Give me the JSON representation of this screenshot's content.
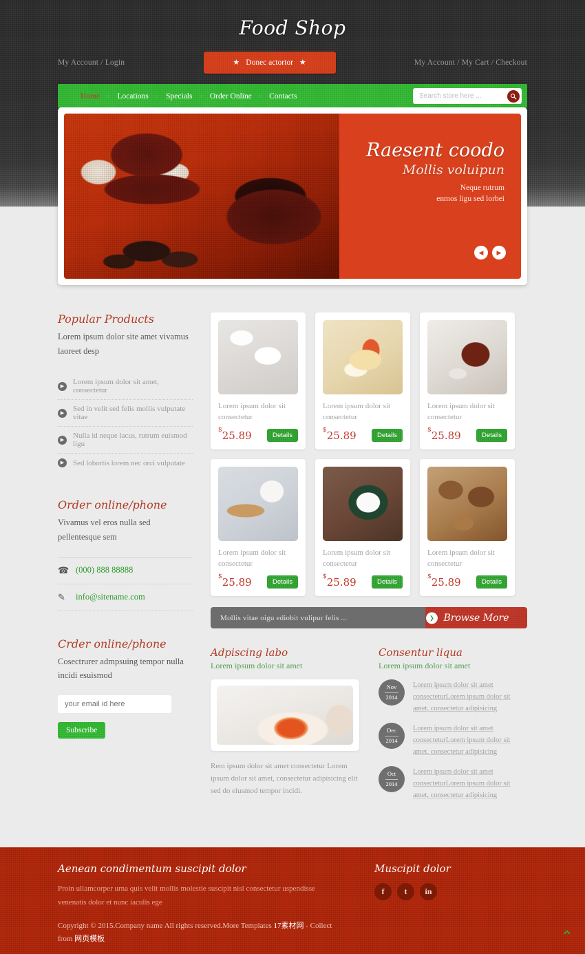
{
  "header": {
    "site_title": "Food Shop",
    "left_link": "My Account / Login",
    "right_link": "My Account / My Cart / Checkout",
    "promo_button": "Donec actortor",
    "star_icon": "★"
  },
  "nav": {
    "items": [
      {
        "label": "Home",
        "active": true
      },
      {
        "label": "Locations",
        "active": false
      },
      {
        "label": "Specials",
        "active": false
      },
      {
        "label": "Order Online",
        "active": false
      },
      {
        "label": "Contacts",
        "active": false
      }
    ],
    "separator": "-",
    "search_placeholder": "Search store here ...",
    "search_value": ""
  },
  "hero": {
    "title": "Raesent coodo",
    "subtitle": "Mollis voluipun",
    "line1": "Neque rutrum",
    "line2": "enmos ligu sed lorbei",
    "prev_icon": "◀",
    "next_icon": "▶"
  },
  "sidebar": {
    "popular": {
      "title": "Popular Products",
      "desc": "Lorem ipsum dolor site amet vivamus laoreet desp",
      "items": [
        "Lorem ipsum dolor sit amet, consectetur",
        "Sed in velit sed felis mollis vulputate vitae",
        "Nulla id neque lacus, rutrum euismod ligu",
        "Sed lobortis lorem nec orci vulputate"
      ]
    },
    "order": {
      "title": "Order online/phone",
      "desc": "Vivamus vel eros nulla sed pellentesque sem",
      "phone": "(000) 888 88888",
      "email": "info@sitename.com",
      "phone_icon": "☎",
      "email_icon": "✎"
    },
    "newsletter": {
      "title": "Crder online/phone",
      "desc": "Cosectrurer admpsuing tempor nulla incidi esuismod",
      "input_placeholder": "your email id here",
      "input_value": "",
      "button": "Subscribe"
    }
  },
  "products": [
    {
      "desc": "Lorem ipsum dolor sit consectetur",
      "price": "25.89",
      "currency": "$",
      "details": "Details",
      "img": "p1"
    },
    {
      "desc": "Lorem ipsum dolor sit consectetur",
      "price": "25.89",
      "currency": "$",
      "details": "Details",
      "img": "p2"
    },
    {
      "desc": "Lorem ipsum dolor sit consectetur",
      "price": "25.89",
      "currency": "$",
      "details": "Details",
      "img": "p3"
    },
    {
      "desc": "Lorem ipsum dolor sit consectetur",
      "price": "25.89",
      "currency": "$",
      "details": "Details",
      "img": "p4"
    },
    {
      "desc": "Lorem ipsum dolor sit consectetur",
      "price": "25.89",
      "currency": "$",
      "details": "Details",
      "img": "p5"
    },
    {
      "desc": "Lorem ipsum dolor sit consectetur",
      "price": "25.89",
      "currency": "$",
      "details": "Details",
      "img": "p6"
    }
  ],
  "browse": {
    "text": "Mollis vitae oigu ediobit vulipur felis ...",
    "button": "Browse More",
    "knob_icon": "❯"
  },
  "bottom": {
    "left": {
      "title": "Adpiscing labo",
      "subtitle": "Lorem ipsum dolor sit amet",
      "body": "Rem ipsum dolor sit amet consectetur Lorem ipsum dolor sit amet, consectetur adipisicing elit sed do eiusmod tempor incidi."
    },
    "right": {
      "title": "Consentur liqua",
      "subtitle": "Lorem ipsum dolor sit amet",
      "items": [
        {
          "month": "Nov",
          "year": "2014",
          "text": "Lorem ipsum dolor sit amet consecteturLorem ipsum dolor sit amet, consectetur adipisicing"
        },
        {
          "month": "Dec",
          "year": "2014",
          "text": "Lorem ipsum dolor sit amet consecteturLorem ipsum dolor sit amet, consectetur adipisicing"
        },
        {
          "month": "Oct",
          "year": "2014",
          "text": "Lorem ipsum dolor sit amet consecteturLorem ipsum dolor sit amet, consectetur adipisicing"
        }
      ]
    }
  },
  "footer": {
    "title": "Aenean condimentum suscipit dolor",
    "body": "Proin ullamcorper urna quis velit mollis molestie suscipit nisl consectetur uspendisse venenatis dolor et nunc iaculis ege",
    "copyright": "Copyright © 2015.Company name All rights reserved.More Templates ",
    "copyright_cn1": "17素材网",
    "copyright_mid": " - Collect from ",
    "copyright_cn2": "网页模板",
    "social_title": "Muscipit dolor",
    "social": [
      "f",
      "t",
      "in"
    ],
    "to_top_icon": "⌃"
  },
  "colors": {
    "brand_red": "#c0392b",
    "footer_red": "#b5290d",
    "nav_green": "#2cb22c",
    "header_dark": "#2e2e2e",
    "body_bg": "#ebebeb"
  }
}
